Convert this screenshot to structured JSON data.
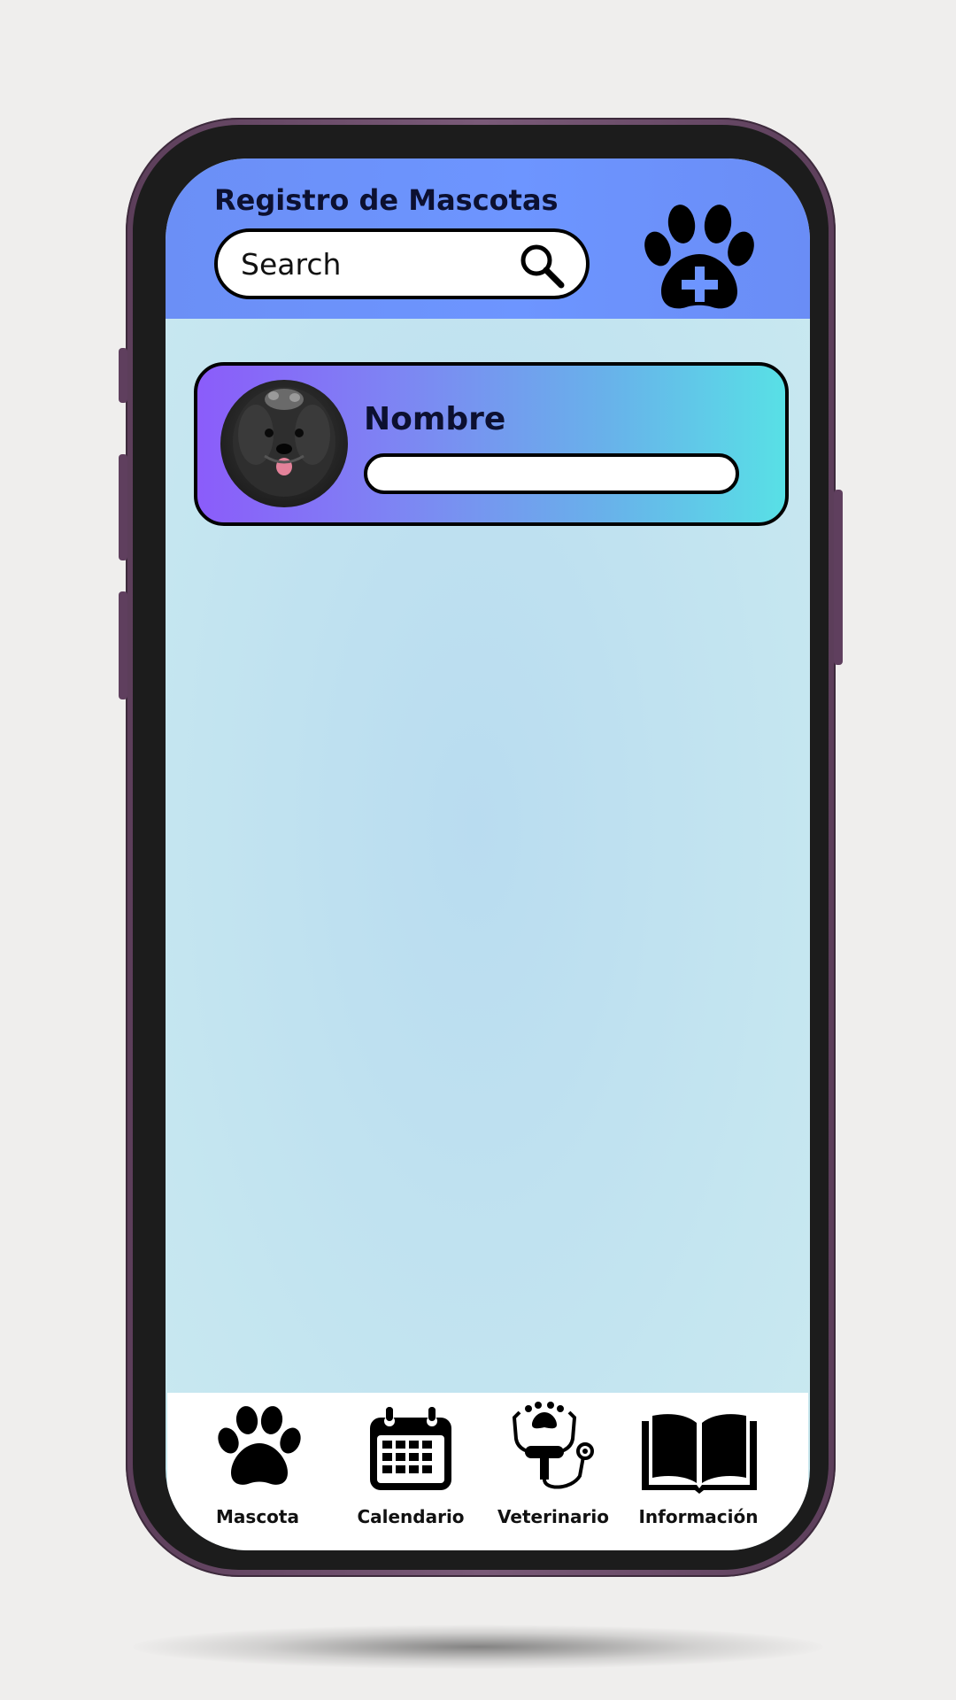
{
  "header": {
    "title": "Registro de Mascotas",
    "search_placeholder": "Search"
  },
  "icons": {
    "search": "search-icon",
    "add_pet": "paw-plus-icon"
  },
  "pet_card": {
    "name_label": "Nombre",
    "name_value": ""
  },
  "tabbar": {
    "tabs": [
      {
        "label": "Mascota",
        "icon": "paw-icon"
      },
      {
        "label": "Calendario",
        "icon": "calendar-icon"
      },
      {
        "label": "Veterinario",
        "icon": "stethoscope-icon"
      },
      {
        "label": "Información",
        "icon": "book-icon"
      }
    ]
  },
  "colors": {
    "header": "#6b8ff6",
    "card_gradient_start": "#8b5cfa",
    "card_gradient_end": "#58e0e6",
    "screen_background": "#c5e6f0",
    "phone_frame": "#6a4a68"
  }
}
